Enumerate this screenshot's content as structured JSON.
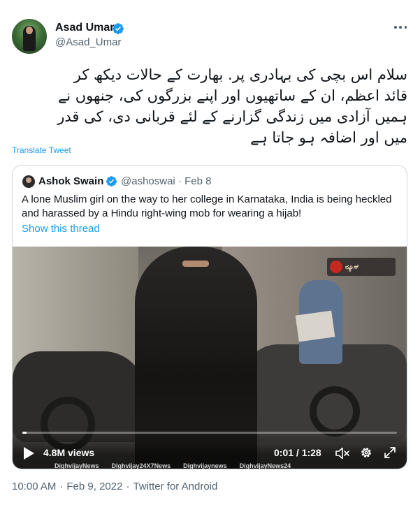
{
  "tweet": {
    "author_name": "Asad Umar",
    "author_handle": "@Asad_Umar",
    "body_lines": [
      "سلام اس بچی کی بہادری پر. بھارت کے حالات دیکھ کر",
      "قائد اعظم، ان کے ساتھیوں اور اپنے بزرگوں کی، جنھوں نے",
      "ہمیں آزادی میں زندگی گزارنے کے لئے قربانی دی، کی قدر",
      "میں اور اضافہ ہو جاتا ہے"
    ],
    "translate_label": "Translate Tweet",
    "time": "10:00 AM",
    "date": "Feb 9, 2022",
    "source": "Twitter for Android",
    "separator": "·"
  },
  "quoted": {
    "author_name": "Ashok Swain",
    "author_handle": "@ashoswai",
    "date": "· Feb 8",
    "text": "A lone Muslim girl on the way to her college in Karnataka, India is being heckled and harassed by a Hindu right-wing mob for wearing a hijab!",
    "show_thread": "Show this thread"
  },
  "video": {
    "views": "4.8M views",
    "time": "0:01 / 1:28",
    "progress_fraction": 0.01,
    "watermarks": [
      "DighvijayNews",
      "Dighvijay24X7News",
      "Dighvijaynews",
      "DighvijayNews24"
    ],
    "channel_logo_text": "ನ್ಯೂಸ್"
  },
  "colors": {
    "link_blue": "#1d9bf0",
    "secondary_text": "#536471",
    "border": "#cfd9de"
  },
  "icons": [
    "verified-badge-icon",
    "more-icon",
    "play-icon",
    "volume-mute-icon",
    "settings-gear-icon",
    "fullscreen-icon"
  ]
}
